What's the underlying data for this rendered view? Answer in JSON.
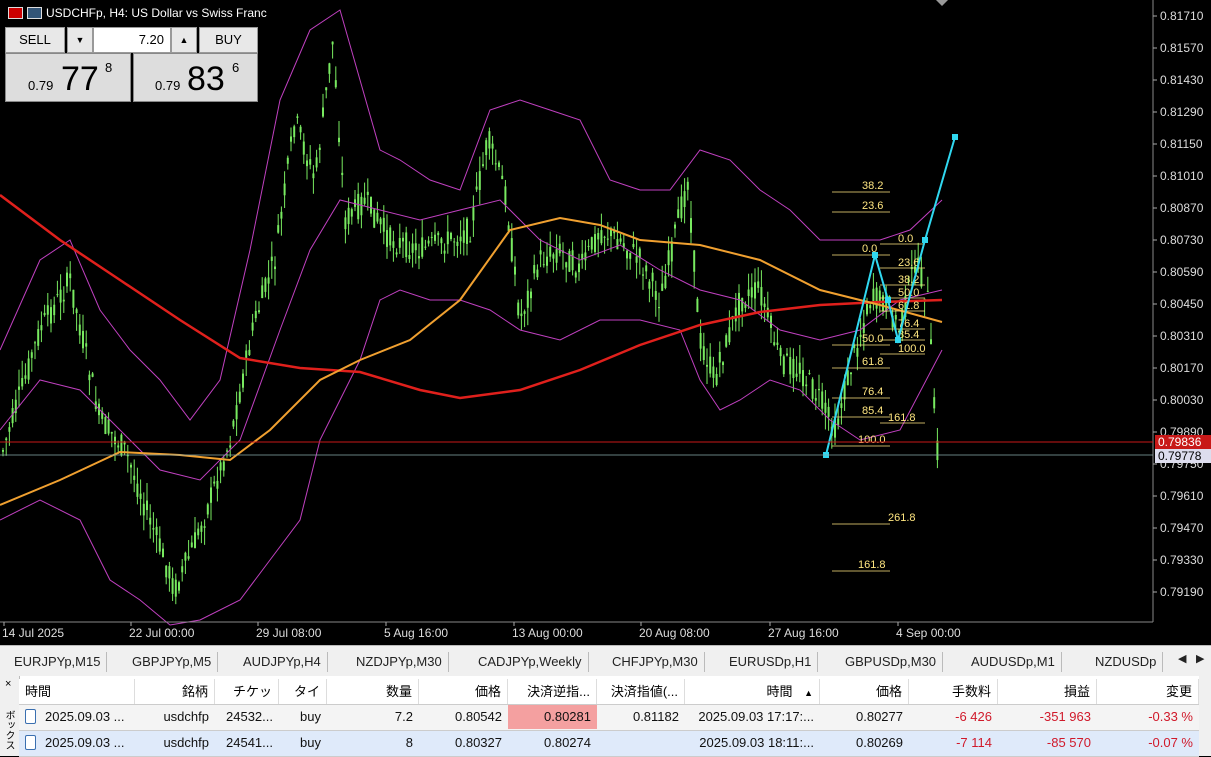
{
  "chart": {
    "title": "USDCHFp, H4:  US Dollar vs Swiss Franc",
    "price_axis": [
      "0.81710",
      "0.81570",
      "0.81430",
      "0.81290",
      "0.81150",
      "0.81010",
      "0.80870",
      "0.80730",
      "0.80590",
      "0.80450",
      "0.80310",
      "0.80170",
      "0.80030",
      "0.79890",
      "0.79750",
      "0.79610",
      "0.79470",
      "0.79330",
      "0.79190"
    ],
    "time_axis": [
      "14 Jul 2025",
      "22 Jul 00:00",
      "29 Jul 08:00",
      "5 Aug 16:00",
      "13 Aug 00:00",
      "20 Aug 08:00",
      "27 Aug 16:00",
      "4 Sep 00:00"
    ],
    "bid_label": "0.79836",
    "current_label": "0.79778",
    "fib_levels_a": [
      "0.0",
      "23.6",
      "38.2",
      "50.0",
      "61.8",
      "76.4",
      "85.4",
      "100.0",
      "161.8",
      "261.8"
    ],
    "fib_levels_b": [
      "0.0",
      "23.6",
      "38.2",
      "50.0",
      "61.8",
      "76.4",
      "85.4",
      "100.0",
      "161.8"
    ],
    "colors": {
      "ma_slow": "#e0201c",
      "ma_fast": "#f0a030",
      "bands": "#c040c0",
      "candles": "#78ea60",
      "zigzag": "#30d8f0",
      "fib": "#ffe680",
      "bid_line": "#c81818"
    }
  },
  "trade_panel": {
    "sell_label": "SELL",
    "buy_label": "BUY",
    "lot": "7.20",
    "sell_small": "0.79",
    "sell_big": "77",
    "sell_sup": "8",
    "buy_small": "0.79",
    "buy_big": "83",
    "buy_sup": "6"
  },
  "symbol_tabs": [
    "EURJPYp,M15",
    "GBPJPYp,M5",
    "AUDJPYp,H4",
    "NZDJPYp,M30",
    "CADJPYp,Weekly",
    "CHFJPYp,M30",
    "EURUSDp,H1",
    "GBPUSDp,M30",
    "AUDUSDp,M1",
    "NZDUSDp"
  ],
  "toolbox": {
    "label": "ボックス",
    "close": "×"
  },
  "table": {
    "headers": [
      "時間",
      "銘柄",
      "チケット",
      "タイプ",
      "数量",
      "価格",
      "決済逆指...",
      "決済指値(...",
      "時間",
      "価格",
      "手数料",
      "損益",
      "変更"
    ],
    "sort_arrow": "▲",
    "rows": [
      {
        "time": "2025.09.03 ...",
        "symbol": "usdchfp",
        "ticket": "24532...",
        "type": "buy",
        "volume": "7.2",
        "price": "0.80542",
        "sl": "0.80281",
        "tp": "0.81182",
        "time2": "2025.09.03 17:17:...",
        "price2": "0.80277",
        "commission": "-6 426",
        "profit": "-351 963",
        "change": "-0.33 %"
      },
      {
        "time": "2025.09.03 ...",
        "symbol": "usdchfp",
        "ticket": "24541...",
        "type": "buy",
        "volume": "8",
        "price": "0.80327",
        "sl": "0.80274",
        "tp": "",
        "time2": "2025.09.03 18:11:...",
        "price2": "0.80269",
        "commission": "-7 114",
        "profit": "-85 570",
        "change": "-0.07 %"
      }
    ]
  }
}
